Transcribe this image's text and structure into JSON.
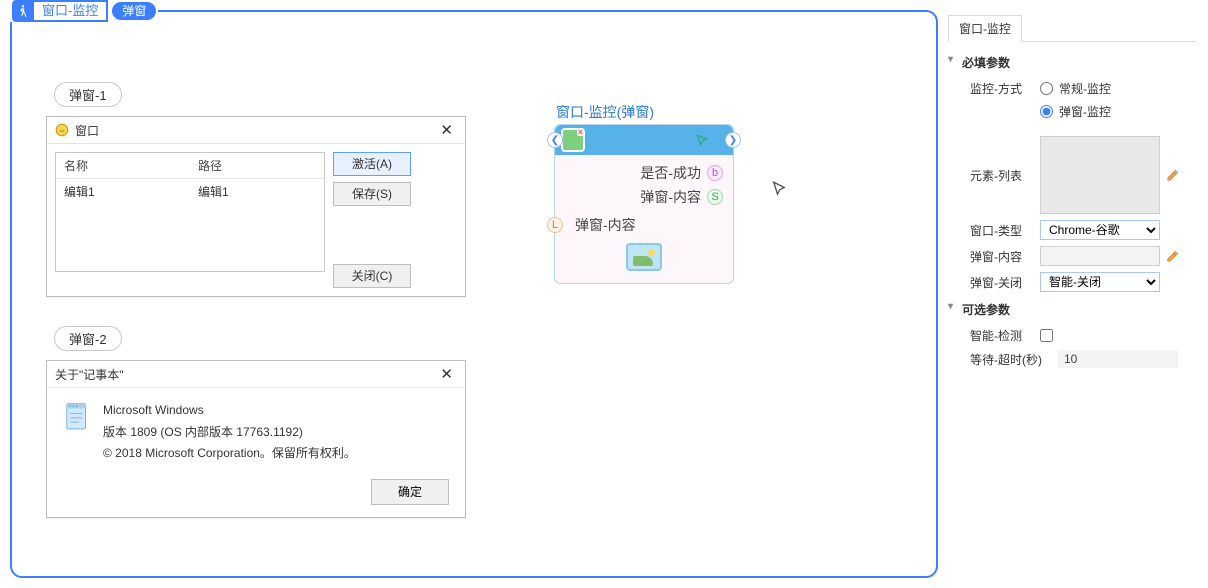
{
  "header": {
    "title": "窗口-监控",
    "badge": "弹窗"
  },
  "chip1": "弹窗-1",
  "chip2": "弹窗-2",
  "win1": {
    "title": "窗口",
    "col1": "名称",
    "col2": "路径",
    "row1c1": "编辑1",
    "row1c2": "编辑1",
    "btn_activate": "激活(A)",
    "btn_save": "保存(S)",
    "btn_close": "关闭(C)"
  },
  "win2": {
    "title": "关于\"记事本\"",
    "line1": "Microsoft Windows",
    "line2": "版本 1809 (OS 内部版本 17763.1192)",
    "line3": "© 2018 Microsoft Corporation。保留所有权利。",
    "btn_ok": "确定"
  },
  "node": {
    "title": "窗口-监控(弹窗)",
    "out1": "是否-成功",
    "out2": "弹窗-内容",
    "in1": "弹窗-内容"
  },
  "panel": {
    "tab": "窗口-监控",
    "sec_required": "必填参数",
    "sec_optional": "可选参数",
    "f_mode": "监控-方式",
    "f_mode_opt1": "常规-监控",
    "f_mode_opt2": "弹窗-监控",
    "f_element": "元素-列表",
    "f_wintype": "窗口-类型",
    "f_wintype_val": "Chrome-谷歌",
    "f_popcontent": "弹窗-内容",
    "f_popclose": "弹窗-关闭",
    "f_popclose_val": "智能-关闭",
    "f_smart": "智能-检测",
    "f_timeout": "等待-超时(秒)",
    "f_timeout_val": "10"
  }
}
